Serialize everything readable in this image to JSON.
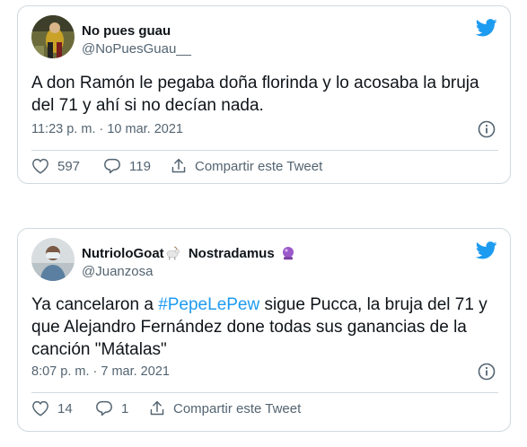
{
  "tweets": [
    {
      "name": "No pues guau",
      "handle": "@NoPuesGuau__",
      "text": "A don Ramón le pegaba doña florinda y lo acosaba la bruja del 71 y ahí si no decían nada.",
      "timestamp": "11:23 p. m. · 10 mar. 2021",
      "likes": "597",
      "replies": "119",
      "share_label": "Compartir este Tweet"
    },
    {
      "name": "NutrioloGoat",
      "name_suffix": "Nostradamus",
      "handle": "@Juanzosa",
      "text_before": "Ya cancelaron a ",
      "hashtag": "#PepeLePew",
      "text_after": " sigue Pucca, la bruja del 71 y que Alejandro Fernández done todas sus ganancias de la canción \"Mátalas\"",
      "timestamp": "8:07 p. m. · 7 mar. 2021",
      "likes": "14",
      "replies": "1",
      "share_label": "Compartir este Tweet"
    }
  ],
  "colors": {
    "accent": "#1d9bf0",
    "text": "#0f1419",
    "muted": "#536471",
    "border": "#cfd9de"
  },
  "icons": [
    "twitter-bird-icon",
    "info-icon",
    "heart-icon",
    "reply-icon",
    "share-icon",
    "goat-emoji-icon",
    "crystal-ball-emoji-icon"
  ]
}
